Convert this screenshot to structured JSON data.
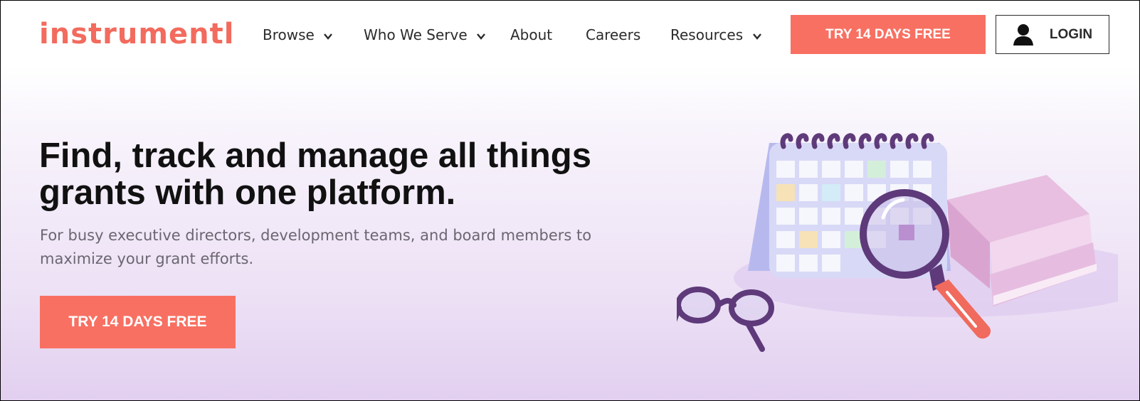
{
  "header": {
    "logo_text": "instrumentl",
    "nav": [
      {
        "label": "Browse",
        "has_dropdown": true
      },
      {
        "label": "Who We Serve",
        "has_dropdown": true
      },
      {
        "label": "About",
        "has_dropdown": false
      },
      {
        "label": "Careers",
        "has_dropdown": false
      },
      {
        "label": "Resources",
        "has_dropdown": true
      }
    ],
    "cta_label": "TRY 14 DAYS FREE",
    "login_label": "LOGIN"
  },
  "hero": {
    "title": "Find, track and manage all things grants with one platform.",
    "subtitle": "For busy executive directors, development teams, and board members to maximize your grant efforts.",
    "cta_label": "TRY 14 DAYS FREE"
  },
  "colors": {
    "brand": "#f26b5e",
    "cta": "#f87062",
    "calendar": "#d8d9f6",
    "magnifier_handle": "#f06a5d",
    "accent_purple": "#5e3a7a"
  },
  "icons": [
    "chevron-down-icon",
    "user-icon",
    "calendar-icon",
    "magnifying-glass-icon",
    "glasses-icon",
    "books-icon"
  ]
}
